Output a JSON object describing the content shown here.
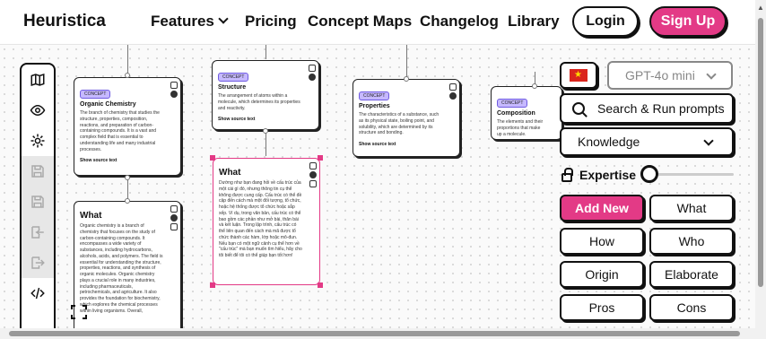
{
  "header": {
    "brand": "Heuristica",
    "nav": {
      "features": "Features",
      "pricing": "Pricing",
      "concept_maps": "Concept Maps",
      "changelog": "Changelog",
      "library": "Library"
    },
    "login": "Login",
    "signup": "Sign Up"
  },
  "toolbar": {
    "icons": [
      "map-icon",
      "eye-icon",
      "gear-icon",
      "save-icon",
      "save-as-icon",
      "import-icon",
      "export-icon",
      "code-icon"
    ]
  },
  "cards": {
    "organic": {
      "badge": "CONCEPT",
      "title": "Organic Chemistry",
      "body": "The branch of chemistry that studies the structure, properties, composition, reactions, and preparation of carbon-containing compounds. It is a vast and complex field that is essential to understanding life and many industrial processes.",
      "source": "Show source text"
    },
    "structure": {
      "badge": "CONCEPT",
      "title": "Structure",
      "body": "The arrangement of atoms within a molecule, which determines its properties and reactivity.",
      "source": "Show source text"
    },
    "properties": {
      "badge": "CONCEPT",
      "title": "Properties",
      "body": "The characteristics of a substance, such as its physical state, boiling point, and solubility, which are determined by its structure and bonding.",
      "source": "Show source text"
    },
    "composition": {
      "badge": "CONCEPT",
      "title": "Composition",
      "body": "The elements and their proportions that make up a molecule.",
      "source": "Show source text"
    },
    "what_vi": {
      "title": "What",
      "body": "Dường như bạn đang hỏi về cấu trúc của một cái gì đó, nhưng thông tin cụ thể không được cung cấp. Cấu trúc có thể đề cập đến cách mà một đối tượng, tổ chức, hoặc hệ thống được tổ chức hoặc sắp xếp. Ví dụ, trong văn bản, cấu trúc có thể bao gồm các phần như mở bài, thân bài và kết luận. Trong lập trình, cấu trúc có thể liên quan đến cách mà mã được tổ chức thành các hàm, lớp hoặc mô-đun. Nếu bạn có một ngữ cảnh cụ thể hơn về \"cấu trúc\" mà bạn muốn tìm hiểu, hãy cho tôi biết để tôi có thể giúp bạn tốt hơn!"
    },
    "what_en": {
      "title": "What",
      "body": "Organic chemistry is a branch of chemistry that focuses on the study of carbon-containing compounds. It encompasses a wide variety of substances, including hydrocarbons, alcohols, acids, and polymers. The field is essential for understanding the structure, properties, reactions, and synthesis of organic molecules. Organic chemistry plays a crucial role in many industries, including pharmaceuticals, petrochemicals, and agriculture. It also provides the foundation for biochemistry, which explores the chemical processes within living organisms. Overall,"
    }
  },
  "panel": {
    "language_flag": "vietnam-flag-icon",
    "model": "GPT-4o mini",
    "search": "Search & Run prompts",
    "knowledge": "Knowledge",
    "expertise": "Expertise",
    "expertise_level": 0,
    "buttons": [
      "Add New",
      "What",
      "How",
      "Who",
      "Origin",
      "Elaborate",
      "Pros",
      "Cons"
    ]
  },
  "colors": {
    "accent": "#e33a86",
    "badge": "#c6b9ff"
  }
}
